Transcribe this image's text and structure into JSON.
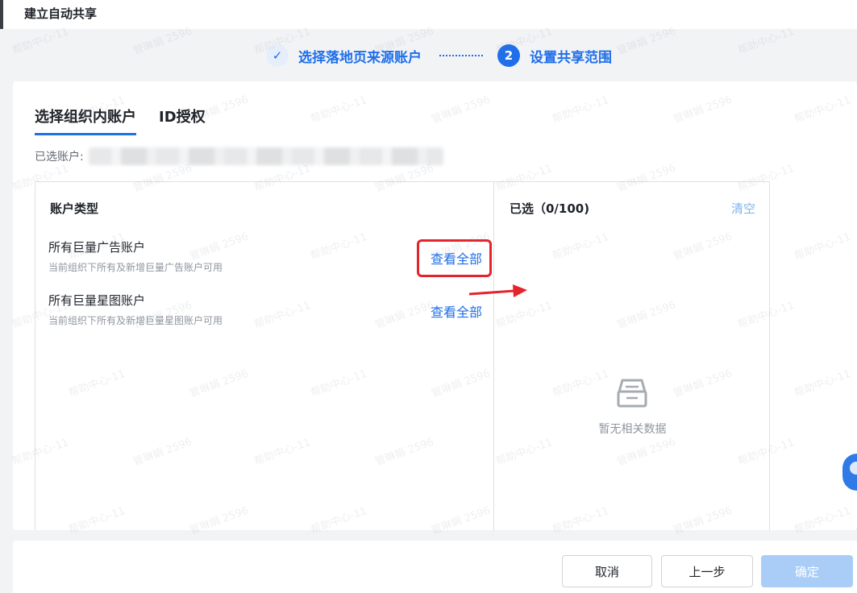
{
  "window": {
    "title": "建立自动共享"
  },
  "steps": [
    {
      "label": "选择落地页来源账户",
      "marker": "✓"
    },
    {
      "label": "设置共享范围",
      "marker": "2"
    }
  ],
  "tabs": [
    {
      "label": "选择组织内账户",
      "active": true
    },
    {
      "label": "ID授权",
      "active": false
    }
  ],
  "selected_accounts": {
    "label": "已选账户:"
  },
  "account_panel": {
    "header": "账户类型",
    "items": [
      {
        "name": "所有巨量广告账户",
        "desc": "当前组织下所有及新增巨量广告账户可用",
        "action": "查看全部",
        "highlighted": true
      },
      {
        "name": "所有巨量星图账户",
        "desc": "当前组织下所有及新增巨量星图账户可用",
        "action": "查看全部",
        "highlighted": false
      }
    ]
  },
  "selected_panel": {
    "header": "已选（0/100)",
    "clear_label": "清空",
    "empty_text": "暂无相关数据",
    "empty_icon": "inbox-icon"
  },
  "footer": {
    "cancel_label": "取消",
    "prev_label": "上一步",
    "confirm_label": "确定"
  },
  "watermark": {
    "lines": [
      "帮助中心-11",
      "管琳娟 2596"
    ]
  },
  "colors": {
    "accent": "#1f6fea",
    "highlight": "#e5232a",
    "confirm_disabled": "#a9cdf6",
    "clear_link": "#7fb3ea"
  }
}
